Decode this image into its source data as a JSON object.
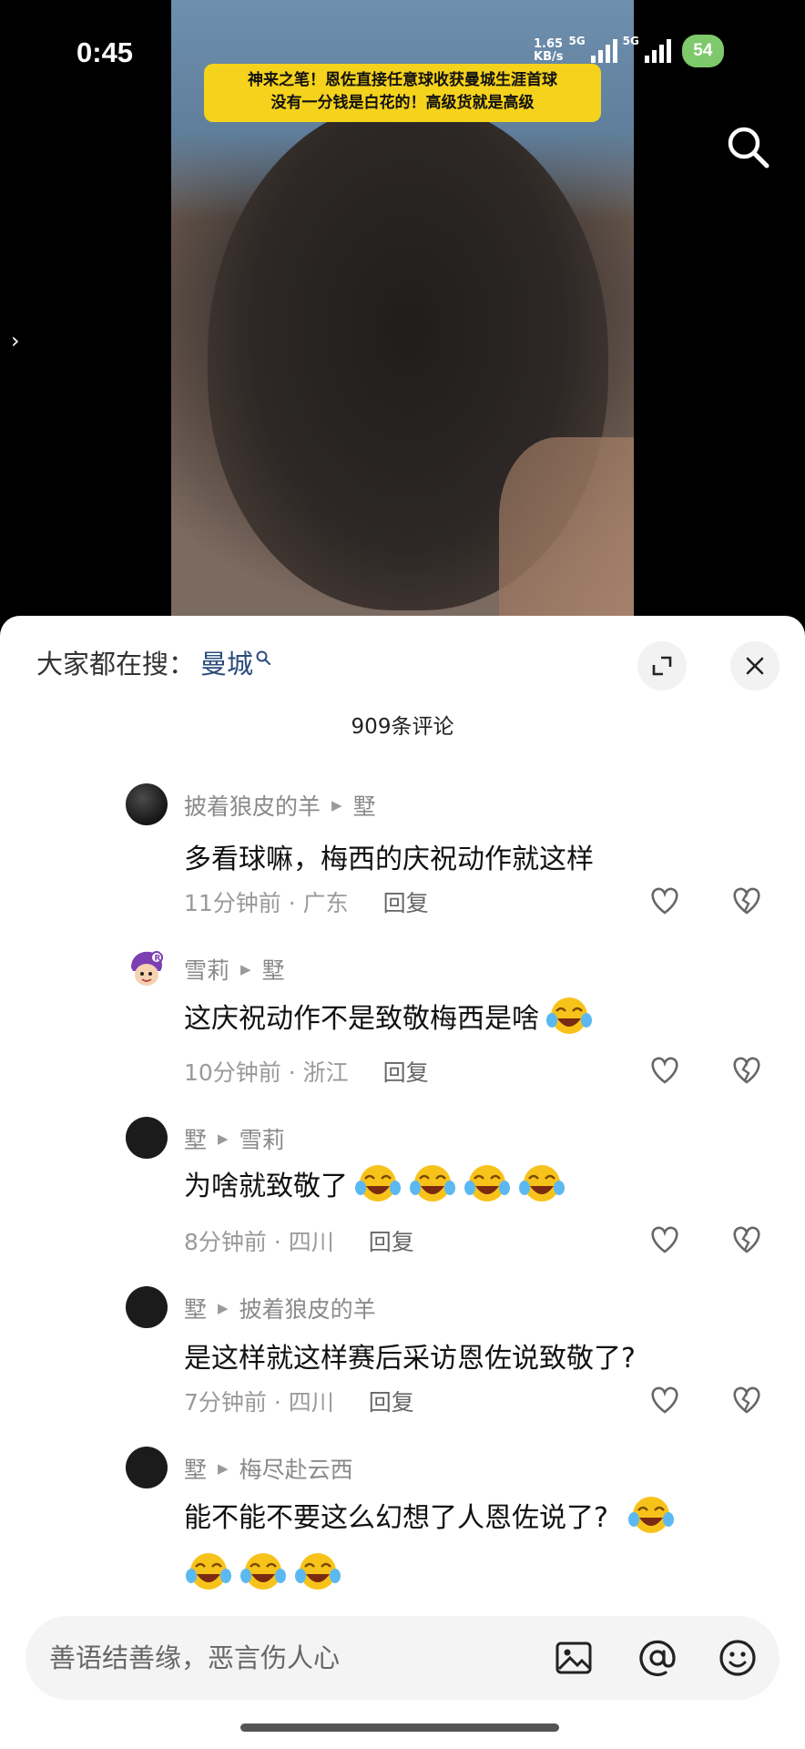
{
  "status_bar": {
    "time": "0:45",
    "net_speed_value": "1.65",
    "net_speed_unit": "KB/s",
    "network_1": "5G",
    "network_2": "5G",
    "battery": "54"
  },
  "video": {
    "caption_line1": "神来之笔！恩佐直接任意球收获曼城生涯首球",
    "caption_line2": "没有一分钱是白花的！高级货就是高级",
    "side_arrow": "›"
  },
  "sheet": {
    "trending_label": "大家都在搜：",
    "trending_keyword": "曼城",
    "comment_count": "909条评论"
  },
  "comments": [
    {
      "author": "披着狼皮的羊",
      "reply_to": "墅",
      "text": "多看球嘛，梅西的庆祝动作就这样",
      "time": "11分钟前",
      "location": "广东",
      "reply_label": "回复",
      "emojis": 0
    },
    {
      "author": "雪莉",
      "reply_to": "墅",
      "text": "这庆祝动作不是致敬梅西是啥",
      "time": "10分钟前",
      "location": "浙江",
      "reply_label": "回复",
      "emojis": 1
    },
    {
      "author": "墅",
      "reply_to": "雪莉",
      "text": "为啥就致敬了",
      "time": "8分钟前",
      "location": "四川",
      "reply_label": "回复",
      "emojis": 4
    },
    {
      "author": "墅",
      "reply_to": "披着狼皮的羊",
      "text": "是这样就这样赛后采访恩佐说致敬了?",
      "time": "7分钟前",
      "location": "四川",
      "reply_label": "回复",
      "emojis": 0
    },
    {
      "author": "墅",
      "reply_to": "梅尽赴云西",
      "text": "能不能不要这么幻想了人恩佐说了?",
      "emojis": 1,
      "emojis_line2": 3
    }
  ],
  "input": {
    "placeholder": "善语结善缘，恶言伤人心"
  },
  "icons": {
    "search": "search-icon",
    "expand": "expand-icon",
    "close": "close-icon",
    "like": "heart-icon",
    "dislike": "broken-heart-icon",
    "image": "image-icon",
    "mention": "at-icon",
    "emoji": "smiley-icon"
  },
  "colors": {
    "caption_bg": "#f5d21c",
    "keyword": "#2a4b7c",
    "battery": "#7ec96b"
  }
}
